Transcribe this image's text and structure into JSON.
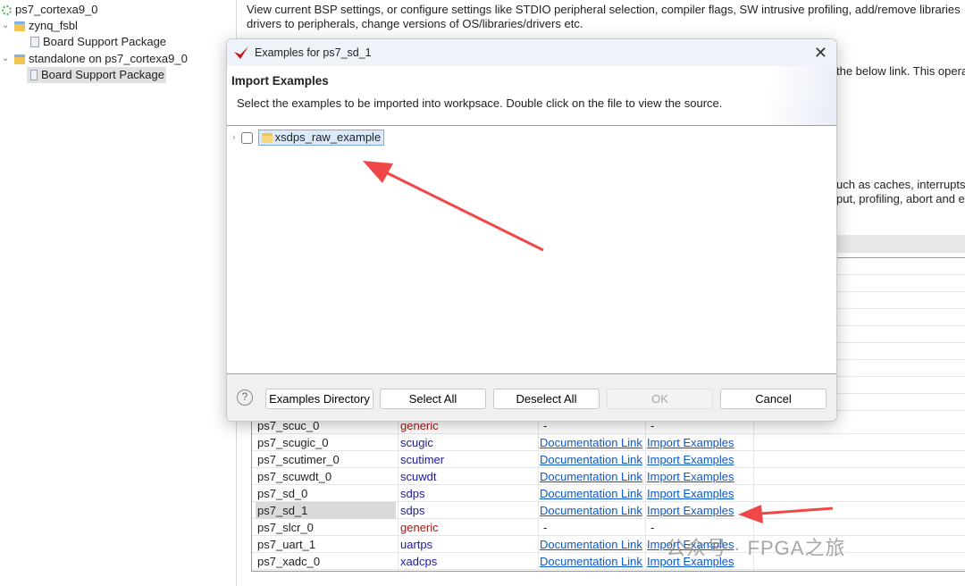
{
  "tree": {
    "items": [
      {
        "label": "ps7_cortexa9_0",
        "icon": "processor-icon"
      },
      {
        "label": "zynq_fsbl",
        "icon": "folder-icon"
      },
      {
        "label": "Board Support Package",
        "icon": "file-icon"
      },
      {
        "label": "standalone on ps7_cortexa9_0",
        "icon": "folder-icon"
      },
      {
        "label": "Board Support Package",
        "icon": "file-icon",
        "selected": true
      }
    ]
  },
  "main": {
    "description_line1": "View current BSP settings, or configure settings like STDIO peripheral selection, compiler flags, SW intrusive profiling, add/remove libraries",
    "description_line2": "drivers to peripherals, change versions of OS/libraries/drivers etc.",
    "partial_text1": "the below link. This opera",
    "partial_text2": "uch as caches, interrupts a",
    "partial_text3": "put, profiling, abort and e",
    "rows": [
      {
        "name": "ps7_scuc_0",
        "driver": "generic",
        "doc": "-",
        "import": "-"
      },
      {
        "name": "ps7_scugic_0",
        "driver": "scugic",
        "doc": "Documentation Link",
        "import": "Import Examples"
      },
      {
        "name": "ps7_scutimer_0",
        "driver": "scutimer",
        "doc": "Documentation Link",
        "import": "Import Examples"
      },
      {
        "name": "ps7_scuwdt_0",
        "driver": "scuwdt",
        "doc": "Documentation Link",
        "import": "Import Examples"
      },
      {
        "name": "ps7_sd_0",
        "driver": "sdps",
        "doc": "Documentation Link",
        "import": "Import Examples"
      },
      {
        "name": "ps7_sd_1",
        "driver": "sdps",
        "doc": "Documentation Link",
        "import": "Import Examples",
        "selected": true
      },
      {
        "name": "ps7_slcr_0",
        "driver": "generic",
        "doc": "-",
        "import": "-"
      },
      {
        "name": "ps7_uart_1",
        "driver": "uartps",
        "doc": "Documentation Link",
        "import": "Import Examples"
      },
      {
        "name": "ps7_xadc_0",
        "driver": "xadcps",
        "doc": "Documentation Link",
        "import": "Import Examples"
      }
    ]
  },
  "dialog": {
    "title": "Examples for ps7_sd_1",
    "heading": "Import Examples",
    "instructions": "Select the examples to be imported into workpsace. Double click on the file to view the source.",
    "examples": [
      {
        "label": "xsdps_raw_example",
        "checked": false
      }
    ],
    "buttons": {
      "examples_dir": "Examples Directory",
      "select_all": "Select All",
      "deselect_all": "Deselect All",
      "ok": "OK",
      "cancel": "Cancel"
    }
  },
  "watermark": "公众号 · FPGA之旅",
  "colors": {
    "accent_arrow": "#f04848",
    "link": "#0a58ca",
    "driver": "#1a1aa0",
    "generic": "#a01818"
  }
}
